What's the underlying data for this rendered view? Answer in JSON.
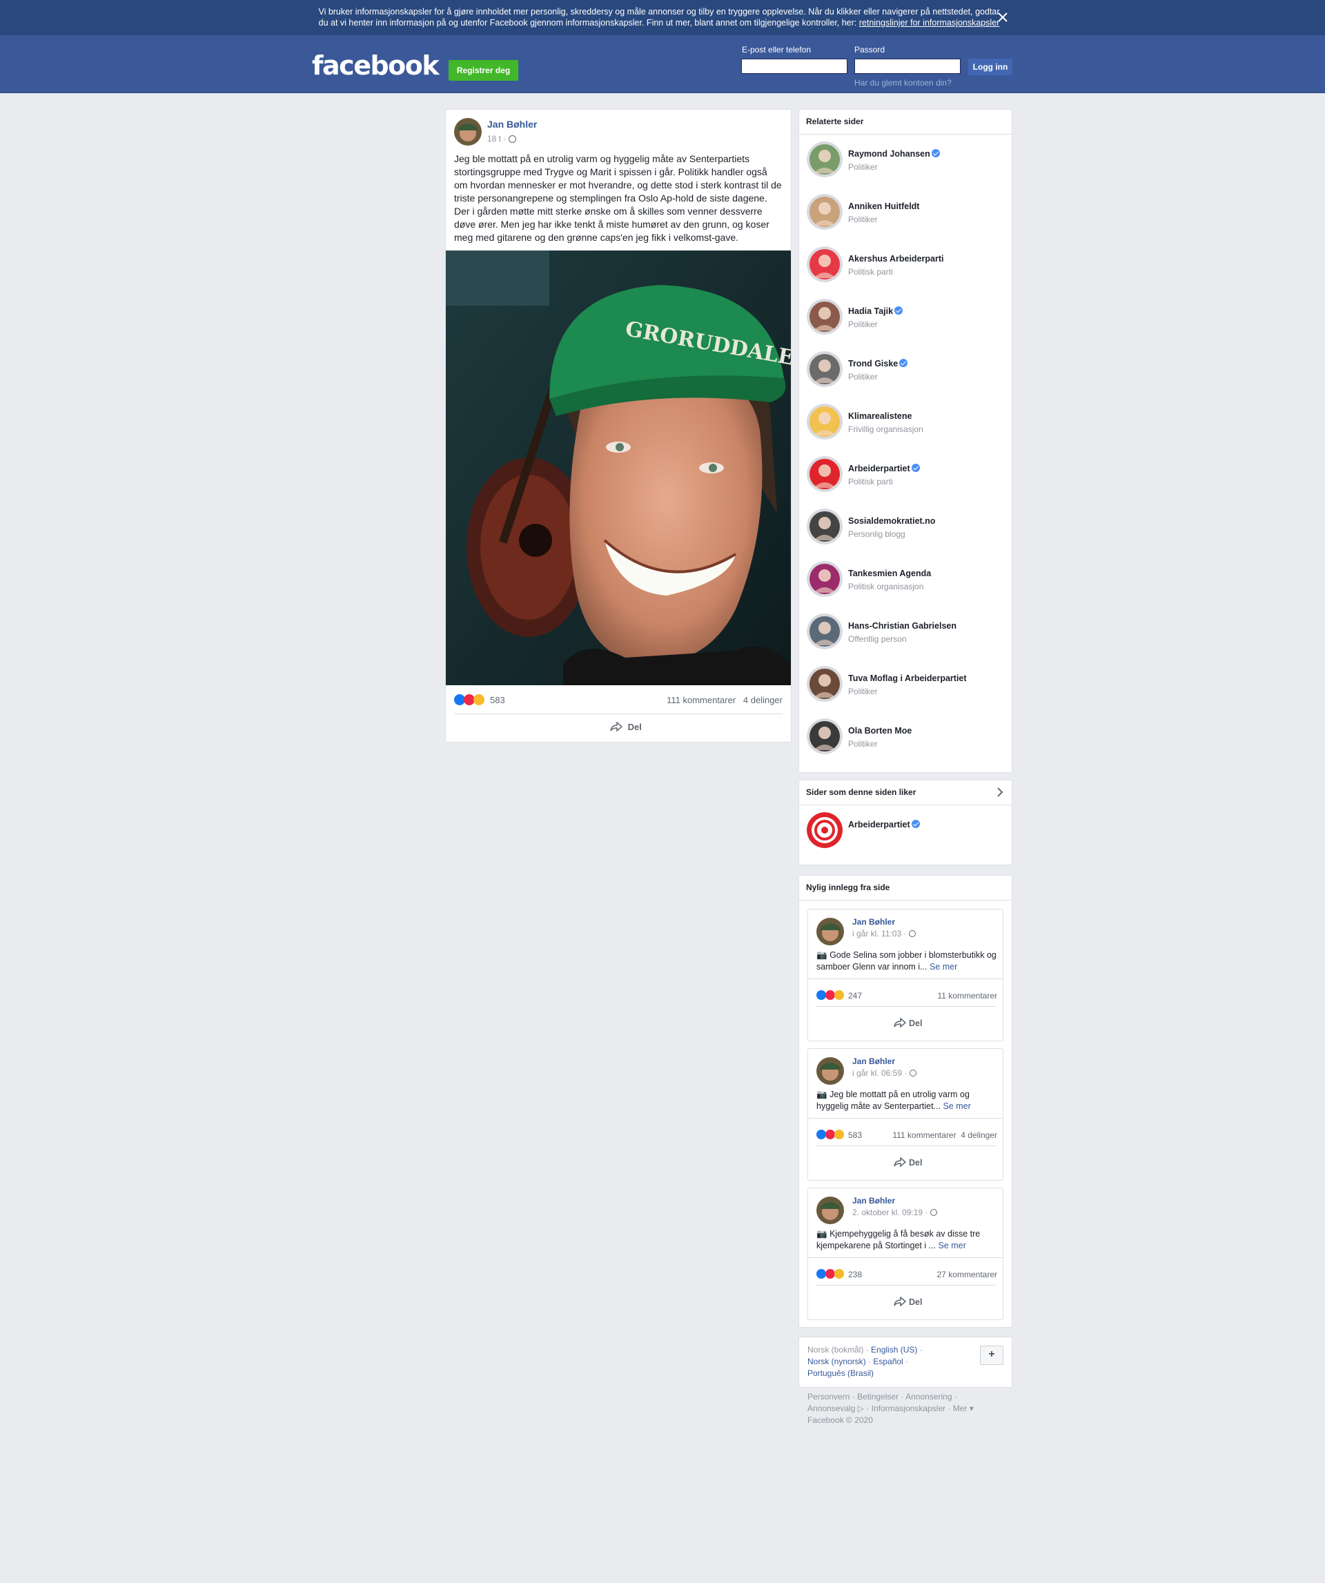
{
  "cookie_banner": {
    "text": "Vi bruker informasjonskapsler for å gjøre innholdet mer personlig, skreddersy og måle annonser og tilby en tryggere opplevelse. Når du klikker eller navigerer på nettstedet, godtar du at vi henter inn informasjon på og utenfor Facebook gjennom informasjonskapsler. Finn ut mer, blant annet om tilgjengelige kontroller, her:",
    "link": "retningslinjer for informasjonskapsler"
  },
  "header": {
    "logo": "facebook",
    "register": "Registrer deg",
    "email_label": "E-post eller telefon",
    "password_label": "Passord",
    "login": "Logg inn",
    "forgot": "Har du glemt kontoen din?"
  },
  "post": {
    "author": "Jan Bøhler",
    "time": "18 t ·",
    "text": "Jeg ble mottatt på en utrolig varm og hyggelig måte av Senterpartiets stortingsgruppe med Trygve og Marit i spissen i går. Politikk handler også om hvordan mennesker er mot hverandre, og dette stod i sterk kontrast til de triste personangrepene og stemplingen fra Oslo Ap-hold de siste dagene. Der i gården møtte mitt sterke ønske om å skilles som venner dessverre døve ører. Men jeg har ikke tenkt å miste humøret av den grunn, og koser meg med gitarene og den grønne caps'en jeg fikk i velkomst-gave.",
    "cap_text": "GRORUDDALEN",
    "reactions": "583",
    "comments": "111 kommentarer",
    "shares": "4 delinger",
    "share": "Del"
  },
  "related": {
    "title": "Relaterte sider",
    "items": [
      {
        "name": "Raymond Johansen",
        "category": "Politiker",
        "verified": true,
        "color": "#7a9c6a"
      },
      {
        "name": "Anniken Huitfeldt",
        "category": "Politiker",
        "verified": false,
        "color": "#c9a27a"
      },
      {
        "name": "Akershus Arbeiderparti",
        "category": "Politisk parti",
        "verified": false,
        "color": "#e63946"
      },
      {
        "name": "Hadia Tajik",
        "category": "Politiker",
        "verified": true,
        "color": "#8b5a4a"
      },
      {
        "name": "Trond Giske",
        "category": "Politiker",
        "verified": true,
        "color": "#6b6b6b"
      },
      {
        "name": "Klimarealistene",
        "category": "Frivillig organisasjon",
        "verified": false,
        "color": "#f2c14e"
      },
      {
        "name": "Arbeiderpartiet",
        "category": "Politisk parti",
        "verified": true,
        "color": "#e0242b"
      },
      {
        "name": "Sosialdemokratiet.no",
        "category": "Personlig blogg",
        "verified": false,
        "color": "#444444"
      },
      {
        "name": "Tankesmien Agenda",
        "category": "Politisk organisasjon",
        "verified": false,
        "color": "#9c2b6b"
      },
      {
        "name": "Hans-Christian Gabrielsen",
        "category": "Offentlig person",
        "verified": false,
        "color": "#5b6a78"
      },
      {
        "name": "Tuva Moflag i Arbeiderpartiet",
        "category": "Politiker",
        "verified": false,
        "color": "#6b4a3a"
      },
      {
        "name": "Ola Borten Moe",
        "category": "Politiker",
        "verified": false,
        "color": "#3a3a3a"
      }
    ]
  },
  "liked": {
    "title": "Sider som denne siden liker",
    "items": [
      {
        "name": "Arbeiderpartiet",
        "verified": true
      }
    ]
  },
  "recent": {
    "title": "Nylig innlegg fra side",
    "posts": [
      {
        "author": "Jan Bøhler",
        "time": "i går kl. 11:03 ·",
        "text": "Gode Selina som jobber i blomsterbutikk og samboer Glenn var innom i...",
        "more": "Se mer",
        "reactions": "247",
        "comments": "11 kommentarer",
        "shares": "",
        "share": "Del"
      },
      {
        "author": "Jan Bøhler",
        "time": "i går kl. 06:59 ·",
        "text": "Jeg ble mottatt på en utrolig varm og hyggelig måte av Senterpartiet...",
        "more": "Se mer",
        "reactions": "583",
        "comments": "111 kommentarer",
        "shares": "4 delinger",
        "share": "Del"
      },
      {
        "author": "Jan Bøhler",
        "time": "2. oktober kl. 09:19 ·",
        "text": "Kjempehyggelig å få besøk av disse tre kjempekarene på Stortinget i ...",
        "more": "Se mer",
        "reactions": "238",
        "comments": "27 kommentarer",
        "shares": "",
        "share": "Del"
      }
    ]
  },
  "languages": {
    "current": "Norsk (bokmål)",
    "others": [
      "English (US)",
      "Norsk (nynorsk)",
      "Español",
      "Português (Brasil)"
    ],
    "add": "+"
  },
  "footer": {
    "links": [
      "Personvern",
      "Betingelser",
      "Annonsering",
      "Annonsevalg",
      "Informasjonskapsler",
      "Mer"
    ],
    "copyright": "Facebook © 2020"
  }
}
